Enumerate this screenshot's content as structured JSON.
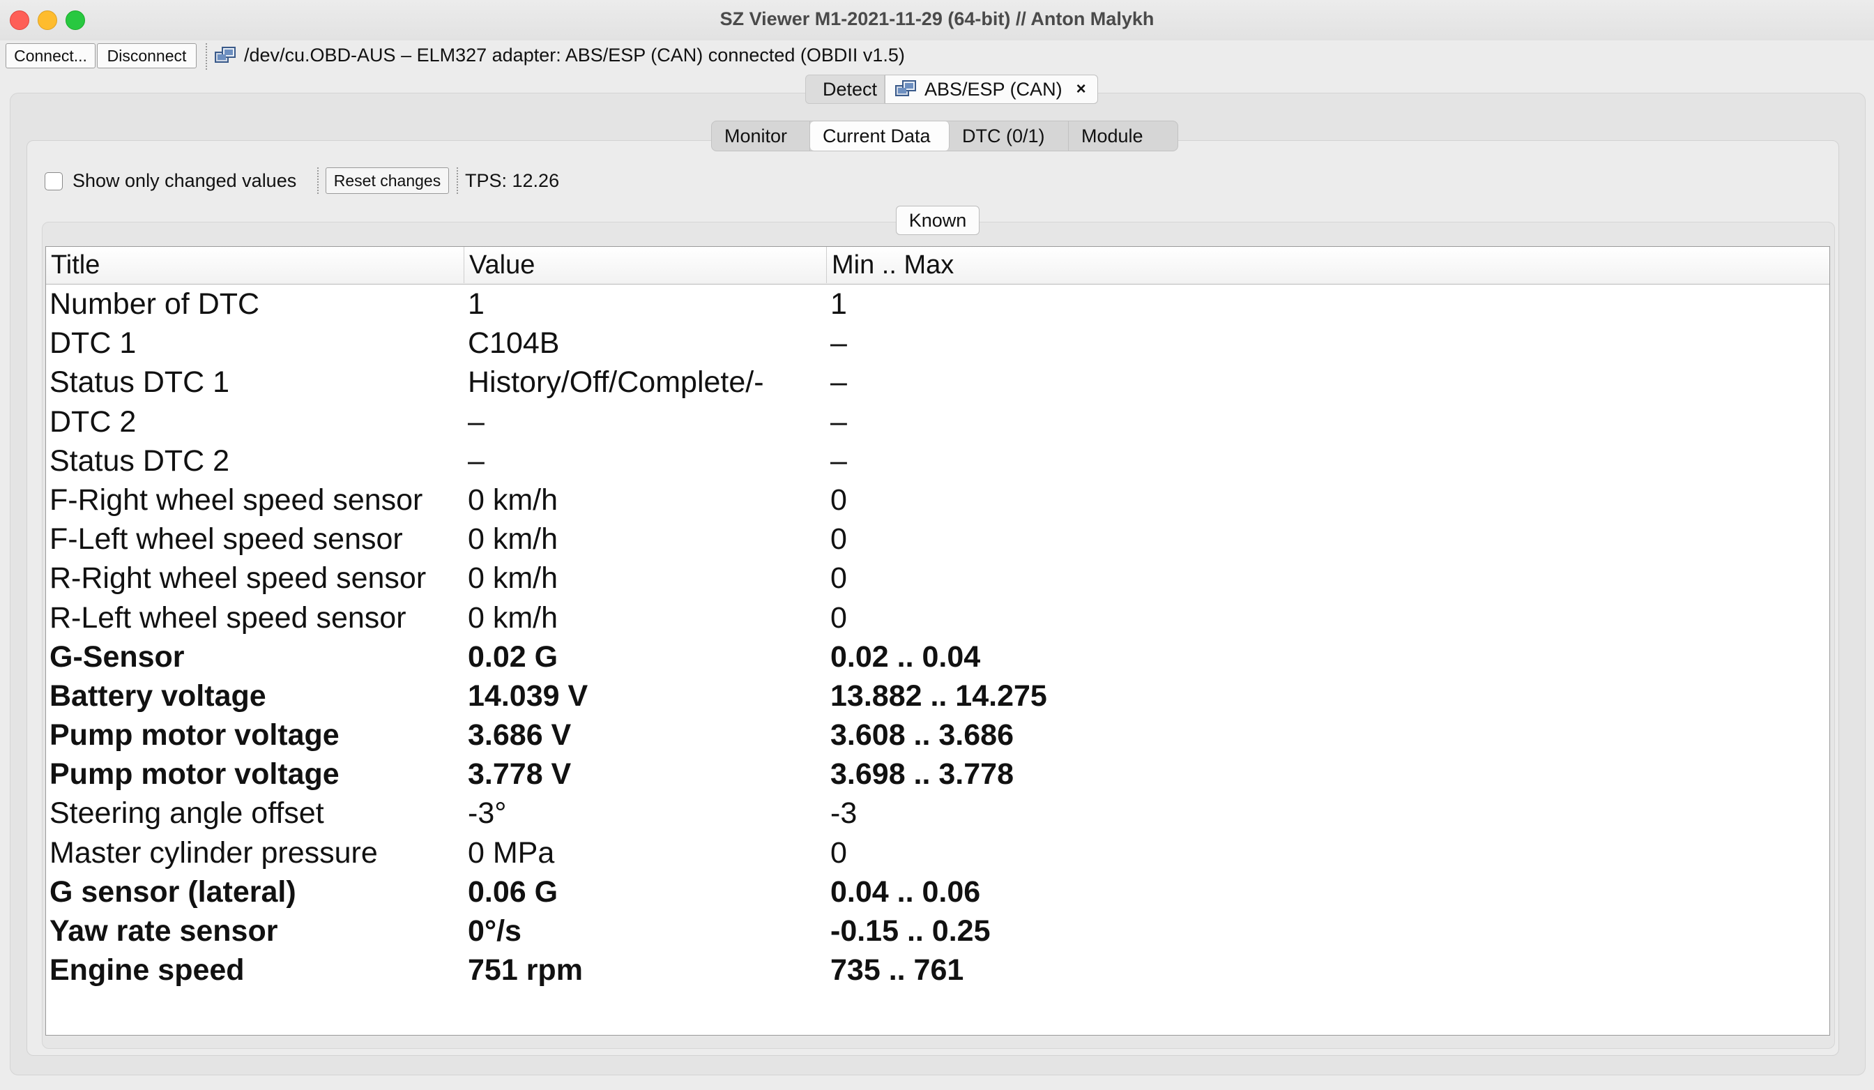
{
  "window": {
    "title": "SZ Viewer M1-2021-11-29 (64-bit) // Anton Malykh"
  },
  "toolbar": {
    "connect_label": "Connect...",
    "disconnect_label": "Disconnect",
    "status": "/dev/cu.OBD-AUS – ELM327 adapter: ABS/ESP (CAN) connected (OBDII  v1.5)"
  },
  "outer_tabs": [
    {
      "label": "Detect",
      "icon": "footprints-icon"
    },
    {
      "label": "ABS/ESP (CAN)",
      "icon": "module-icon",
      "close": "×"
    }
  ],
  "inner_tabs": [
    {
      "label": "Monitor"
    },
    {
      "label": "Current Data"
    },
    {
      "label": "DTC (0/1)"
    },
    {
      "label": "Module"
    }
  ],
  "controls": {
    "show_changed_label": "Show only changed values",
    "show_changed_checked": false,
    "reset_label": "Reset changes",
    "tps": "TPS: 12.26"
  },
  "group": {
    "label": "Known"
  },
  "table": {
    "columns": [
      "Title",
      "Value",
      "Min .. Max"
    ],
    "rows": [
      {
        "title": "Number of DTC",
        "value": "1",
        "range": "1",
        "bold": false
      },
      {
        "title": "DTC 1",
        "value": "C104B",
        "range": "–",
        "bold": false
      },
      {
        "title": "Status DTC 1",
        "value": "History/Off/Complete/-",
        "range": "–",
        "bold": false
      },
      {
        "title": "DTC 2",
        "value": "–",
        "range": "–",
        "bold": false
      },
      {
        "title": "Status DTC 2",
        "value": "–",
        "range": "–",
        "bold": false
      },
      {
        "title": "F-Right wheel speed sensor",
        "value": "0 km/h",
        "range": "0",
        "bold": false
      },
      {
        "title": "F-Left wheel speed sensor",
        "value": "0 km/h",
        "range": "0",
        "bold": false
      },
      {
        "title": "R-Right wheel speed sensor",
        "value": "0 km/h",
        "range": "0",
        "bold": false
      },
      {
        "title": "R-Left wheel speed sensor",
        "value": "0 km/h",
        "range": "0",
        "bold": false
      },
      {
        "title": "G-Sensor",
        "value": "0.02 G",
        "range": "0.02 .. 0.04",
        "bold": true
      },
      {
        "title": "Battery voltage",
        "value": "14.039 V",
        "range": "13.882 .. 14.275",
        "bold": true
      },
      {
        "title": "Pump motor voltage",
        "value": "3.686 V",
        "range": "3.608 .. 3.686",
        "bold": true
      },
      {
        "title": "Pump motor voltage",
        "value": "3.778 V",
        "range": "3.698 .. 3.778",
        "bold": true
      },
      {
        "title": "Steering angle offset",
        "value": "-3°",
        "range": "-3",
        "bold": false
      },
      {
        "title": "Master cylinder pressure",
        "value": "0 MPa",
        "range": "0",
        "bold": false
      },
      {
        "title": "G sensor (lateral)",
        "value": "0.06 G",
        "range": "0.04 .. 0.06",
        "bold": true
      },
      {
        "title": "Yaw rate sensor",
        "value": "0°/s",
        "range": "-0.15 .. 0.25",
        "bold": true
      },
      {
        "title": "Engine speed",
        "value": "751 rpm",
        "range": "735 .. 761",
        "bold": true
      }
    ]
  }
}
